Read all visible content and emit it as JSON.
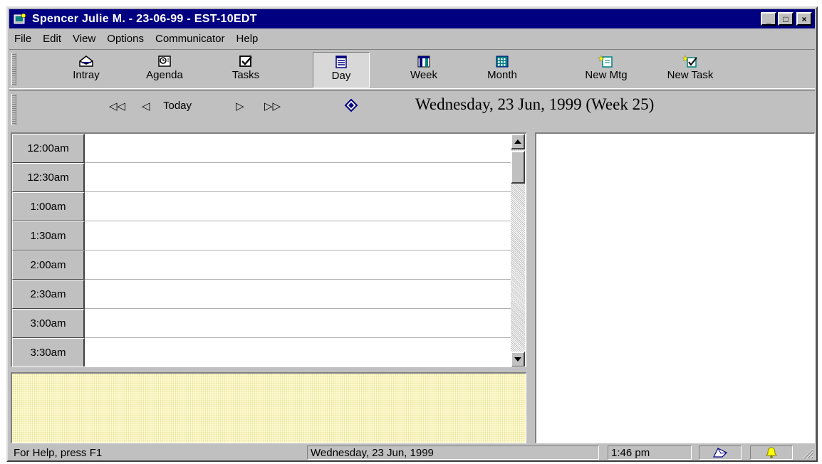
{
  "window": {
    "title": "Spencer Julie M. - 23-06-99 - EST-10EDT",
    "minimize_glyph": "_",
    "maximize_glyph": "□",
    "close_glyph": "×"
  },
  "menu": [
    "File",
    "Edit",
    "View",
    "Options",
    "Communicator",
    "Help"
  ],
  "toolbar": [
    {
      "label": "Intray",
      "icon": "intray-icon"
    },
    {
      "label": "Agenda",
      "icon": "agenda-icon"
    },
    {
      "label": "Tasks",
      "icon": "tasks-icon"
    },
    {
      "label": "Day",
      "icon": "day-icon",
      "active": true
    },
    {
      "label": "Week",
      "icon": "week-icon"
    },
    {
      "label": "Month",
      "icon": "month-icon"
    },
    {
      "label": "New Mtg",
      "icon": "new-meeting-icon"
    },
    {
      "label": "New Task",
      "icon": "new-task-icon"
    }
  ],
  "nav": {
    "first_glyph": "◁◁",
    "prev_glyph": "◁",
    "today_label": "Today",
    "next_glyph": "▷",
    "last_glyph": "▷▷",
    "date_heading": "Wednesday, 23 Jun, 1999  (Week 25)"
  },
  "day_view": {
    "times": [
      "12:00am",
      "12:30am",
      "1:00am",
      "1:30am",
      "2:00am",
      "2:30am",
      "3:00am",
      "3:30am"
    ]
  },
  "status": {
    "help": "For Help, press F1",
    "date": "Wednesday, 23 Jun, 1999",
    "time": "1:46 pm"
  },
  "colors": {
    "title_bar": "#000080",
    "face": "#c0c0c0",
    "notes_bg": "#fffbd0"
  }
}
